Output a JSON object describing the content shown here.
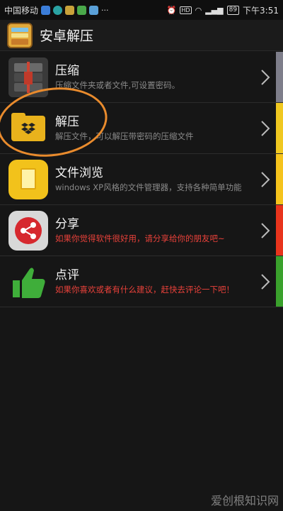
{
  "status_bar": {
    "carrier": "中国移动",
    "battery": "89",
    "time": "下午3:51"
  },
  "app": {
    "title": "安卓解压"
  },
  "items": [
    {
      "title": "压缩",
      "desc": "压缩文件夹或者文件,可设置密码。",
      "desc_color": "gray",
      "accent": "#7e7e8a",
      "icon": "compress-icon"
    },
    {
      "title": "解压",
      "desc": "解压文件，可以解压带密码的压缩文件",
      "desc_color": "gray",
      "accent": "#f0c820",
      "icon": "folder-box-icon"
    },
    {
      "title": "文件浏览",
      "desc": "windows XP风格的文件管理器，支持各种简单功能",
      "desc_color": "gray",
      "accent": "#f5c31c",
      "icon": "document-icon"
    },
    {
      "title": "分享",
      "desc": "如果你觉得软件很好用，请分享给你的朋友吧~",
      "desc_color": "red",
      "accent": "#e8341c",
      "icon": "share-icon"
    },
    {
      "title": "点评",
      "desc": "如果你喜欢或者有什么建议，赶快去评论一下吧！",
      "desc_color": "red",
      "accent": "#3aa12c",
      "icon": "thumbs-up-icon"
    }
  ],
  "colors": {
    "highlight_ring": "#e98b2d",
    "accent_red_text": "#e8413a"
  },
  "watermark": "爱创根知识网"
}
